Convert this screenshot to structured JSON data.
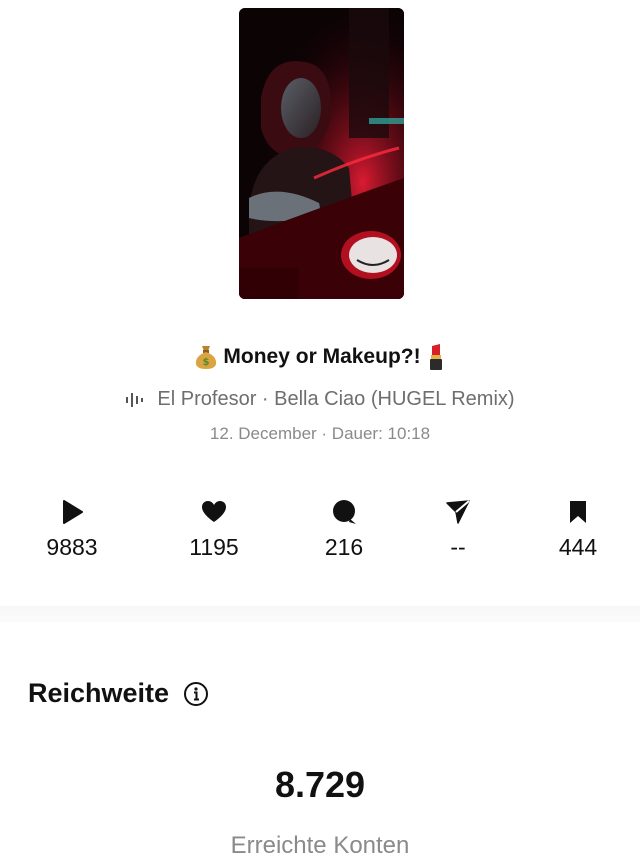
{
  "post": {
    "title": "Money or Makeup?!",
    "title_prefix_icon": "money-bag-emoji",
    "title_suffix_icon": "lipstick-emoji",
    "audio": "El Profesor · Bella Ciao (HUGEL Remix)",
    "meta": "12. December · Dauer: 10:18"
  },
  "stats": [
    {
      "icon": "play-icon",
      "value": "9883"
    },
    {
      "icon": "heart-icon",
      "value": "1195"
    },
    {
      "icon": "comment-icon",
      "value": "216"
    },
    {
      "icon": "share-icon",
      "value": "--"
    },
    {
      "icon": "bookmark-icon",
      "value": "444"
    }
  ],
  "reach": {
    "title": "Reichweite",
    "value": "8.729",
    "label": "Erreichte Konten"
  },
  "colors": {
    "text": "#111111",
    "secondary": "#8a8a8a",
    "thumbnail_accent": "#e0152a"
  }
}
